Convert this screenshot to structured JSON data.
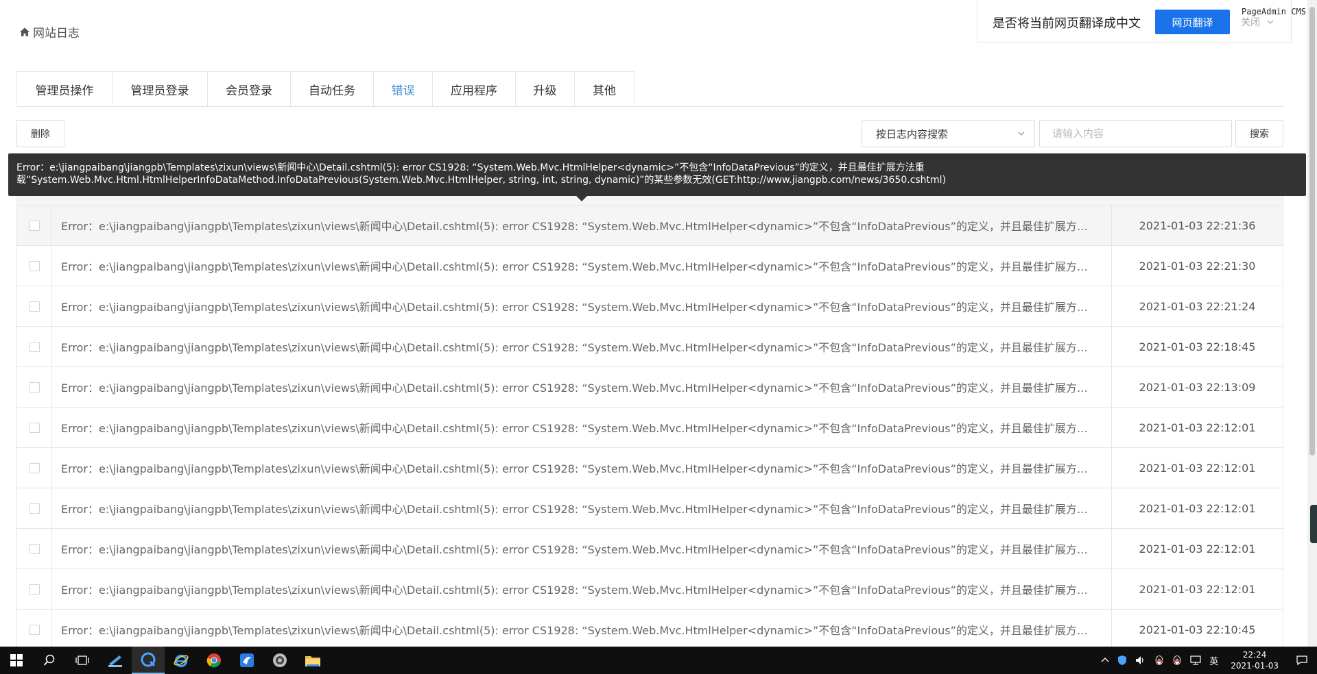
{
  "page": {
    "title": "网站日志"
  },
  "translate_bar": {
    "prompt": "是否将当前网页翻译成中文",
    "button": "网页翻译",
    "close": "关闭",
    "brand": "PageAdmin CMS"
  },
  "tabs": [
    {
      "label": "管理员操作",
      "active": false
    },
    {
      "label": "管理员登录",
      "active": false
    },
    {
      "label": "会员登录",
      "active": false
    },
    {
      "label": "自动任务",
      "active": false
    },
    {
      "label": "错误",
      "active": true
    },
    {
      "label": "应用程序",
      "active": false
    },
    {
      "label": "升级",
      "active": false
    },
    {
      "label": "其他",
      "active": false
    }
  ],
  "toolbar": {
    "delete_label": "删除",
    "filter_selected": "按日志内容搜索",
    "search_placeholder": "请输入内容",
    "search_label": "搜索"
  },
  "tooltip": {
    "line1": "Error：e:\\jiangpaibang\\jiangpb\\Templates\\zixun\\views\\新闻中心\\Detail.cshtml(5): error CS1928: “System.Web.Mvc.HtmlHelper<dynamic>”不包含“InfoDataPrevious”的定义，并且最佳扩展方法重",
    "line2": "载“System.Web.Mvc.Html.HtmlHelperInfoDataMethod.InfoDataPrevious(System.Web.Mvc.HtmlHelper, string, int, string, dynamic)”的某些参数无效(GET:http://www.jiangpb.com/news/3650.cshtml)"
  },
  "rows": [
    {
      "message": "Error：e:\\jiangpaibang\\jiangpb\\Templates\\zixun\\views\\新闻中心\\Detail.cshtml(5): error CS1928: “System.Web.Mvc.HtmlHelper<dynamic>”不包含“InfoDataPrevious”的定义，并且最佳扩展方法重…",
      "time": "2021-01-03 22:21:36"
    },
    {
      "message": "Error：e:\\jiangpaibang\\jiangpb\\Templates\\zixun\\views\\新闻中心\\Detail.cshtml(5): error CS1928: “System.Web.Mvc.HtmlHelper<dynamic>”不包含“InfoDataPrevious”的定义，并且最佳扩展方法重…",
      "time": "2021-01-03 22:21:30"
    },
    {
      "message": "Error：e:\\jiangpaibang\\jiangpb\\Templates\\zixun\\views\\新闻中心\\Detail.cshtml(5): error CS1928: “System.Web.Mvc.HtmlHelper<dynamic>”不包含“InfoDataPrevious”的定义，并且最佳扩展方法重…",
      "time": "2021-01-03 22:21:24"
    },
    {
      "message": "Error：e:\\jiangpaibang\\jiangpb\\Templates\\zixun\\views\\新闻中心\\Detail.cshtml(5): error CS1928: “System.Web.Mvc.HtmlHelper<dynamic>”不包含“InfoDataPrevious”的定义，并且最佳扩展方法重…",
      "time": "2021-01-03 22:18:45"
    },
    {
      "message": "Error：e:\\jiangpaibang\\jiangpb\\Templates\\zixun\\views\\新闻中心\\Detail.cshtml(5): error CS1928: “System.Web.Mvc.HtmlHelper<dynamic>”不包含“InfoDataPrevious”的定义，并且最佳扩展方法重…",
      "time": "2021-01-03 22:13:09"
    },
    {
      "message": "Error：e:\\jiangpaibang\\jiangpb\\Templates\\zixun\\views\\新闻中心\\Detail.cshtml(5): error CS1928: “System.Web.Mvc.HtmlHelper<dynamic>”不包含“InfoDataPrevious”的定义，并且最佳扩展方法重…",
      "time": "2021-01-03 22:12:01"
    },
    {
      "message": "Error：e:\\jiangpaibang\\jiangpb\\Templates\\zixun\\views\\新闻中心\\Detail.cshtml(5): error CS1928: “System.Web.Mvc.HtmlHelper<dynamic>”不包含“InfoDataPrevious”的定义，并且最佳扩展方法重…",
      "time": "2021-01-03 22:12:01"
    },
    {
      "message": "Error：e:\\jiangpaibang\\jiangpb\\Templates\\zixun\\views\\新闻中心\\Detail.cshtml(5): error CS1928: “System.Web.Mvc.HtmlHelper<dynamic>”不包含“InfoDataPrevious”的定义，并且最佳扩展方法重…",
      "time": "2021-01-03 22:12:01"
    },
    {
      "message": "Error：e:\\jiangpaibang\\jiangpb\\Templates\\zixun\\views\\新闻中心\\Detail.cshtml(5): error CS1928: “System.Web.Mvc.HtmlHelper<dynamic>”不包含“InfoDataPrevious”的定义，并且最佳扩展方法重…",
      "time": "2021-01-03 22:12:01"
    },
    {
      "message": "Error：e:\\jiangpaibang\\jiangpb\\Templates\\zixun\\views\\新闻中心\\Detail.cshtml(5): error CS1928: “System.Web.Mvc.HtmlHelper<dynamic>”不包含“InfoDataPrevious”的定义，并且最佳扩展方法重…",
      "time": "2021-01-03 22:12:01"
    },
    {
      "message": "Error：e:\\jiangpaibang\\jiangpb\\Templates\\zixun\\views\\新闻中心\\Detail.cshtml(5): error CS1928: “System.Web.Mvc.HtmlHelper<dynamic>”不包含“InfoDataPrevious”的定义，并且最佳扩展方法重…",
      "time": "2021-01-03 22:10:45"
    }
  ],
  "taskbar": {
    "apps": [
      "windows-start-icon",
      "search-icon",
      "task-view-icon",
      "pen-tool-icon",
      "qq-browser-icon",
      "ie-icon",
      "chrome-icon",
      "bird-app-icon",
      "gear-app-icon",
      "folder-icon"
    ],
    "ime": "英",
    "time": "22:24",
    "date": "2021-01-03"
  },
  "colors": {
    "accent": "#1a73e8",
    "active_tab": "#3f8cd4",
    "tooltip_bg": "#333333",
    "taskbar_bg": "#0f0f0f"
  }
}
